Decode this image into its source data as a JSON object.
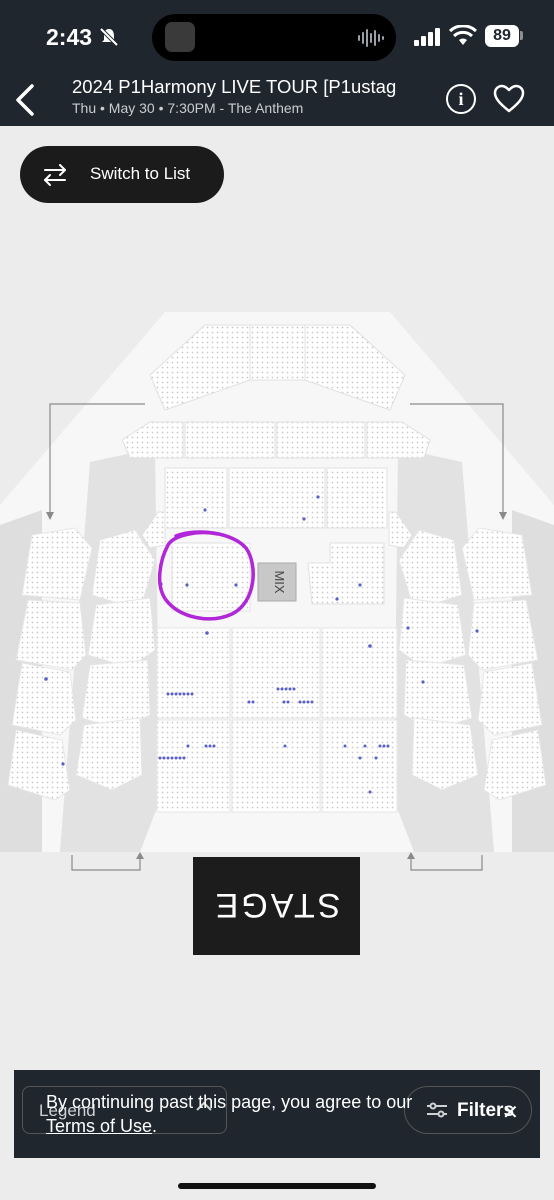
{
  "status_bar": {
    "time": "2:43",
    "battery": "89"
  },
  "event": {
    "title": "2024 P1Harmony LIVE TOUR [P1ustag",
    "subtitle": "Thu • May 30 • 7:30PM - The Anthem"
  },
  "switch_button": {
    "label": "Switch to List"
  },
  "map": {
    "mix_label": "MIX",
    "stage_label": "STAGE"
  },
  "footer": {
    "legend_label": "Legend",
    "filters_label": "Filters"
  },
  "cookie": {
    "text": "By continuing past this page, you agree to our",
    "link": "Terms of Use",
    "suffix": "."
  },
  "colors": {
    "header_bg": "#1f262d",
    "available_seat": "#5a5fc7",
    "highlight": "#b026d8",
    "stage_bg": "#1c1c1c"
  }
}
